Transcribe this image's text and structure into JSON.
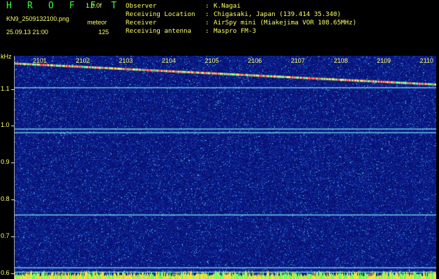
{
  "header": {
    "brand": "H R O F F T",
    "version": "1.0.0f",
    "filename": "KN9_2509132100.png",
    "mode": "meteor",
    "datetime": "25.09.13 21:00",
    "count": "125"
  },
  "info": [
    {
      "label": "Observer",
      "value": "K.Nagai"
    },
    {
      "label": "Receiving Location",
      "value": "Chigasaki, Japan (139.414 35.340)"
    },
    {
      "label": "Receiver",
      "value": "AirSpy mini (Miakejima VOR 108.65MHz)"
    },
    {
      "label": "Receiving antenna",
      "value": "Maspro FM-3"
    }
  ],
  "chart_data": {
    "type": "heatmap",
    "yunit": "kHz",
    "x_ticks": [
      "2101",
      "2102",
      "2103",
      "2104",
      "2105",
      "2106",
      "2107",
      "2108",
      "2109",
      "2110"
    ],
    "y_ticks": [
      "1.1",
      "1.0",
      "0.9",
      "0.8",
      "0.7",
      "0.6"
    ],
    "y_tick_values": [
      1.1,
      1.0,
      0.9,
      0.8,
      0.7,
      0.6
    ],
    "ylim": [
      0.585,
      1.19
    ],
    "xlim": [
      2100.4,
      2110.2
    ],
    "drift_line": {
      "y_start": 1.17,
      "y_end": 1.113
    },
    "steady_lines": [
      1.105,
      0.993,
      0.983,
      0.76,
      0.617,
      0.605
    ],
    "colors": {
      "background": "#0c1a8c",
      "label": "#ffff66",
      "brand": "#36ff36"
    }
  }
}
